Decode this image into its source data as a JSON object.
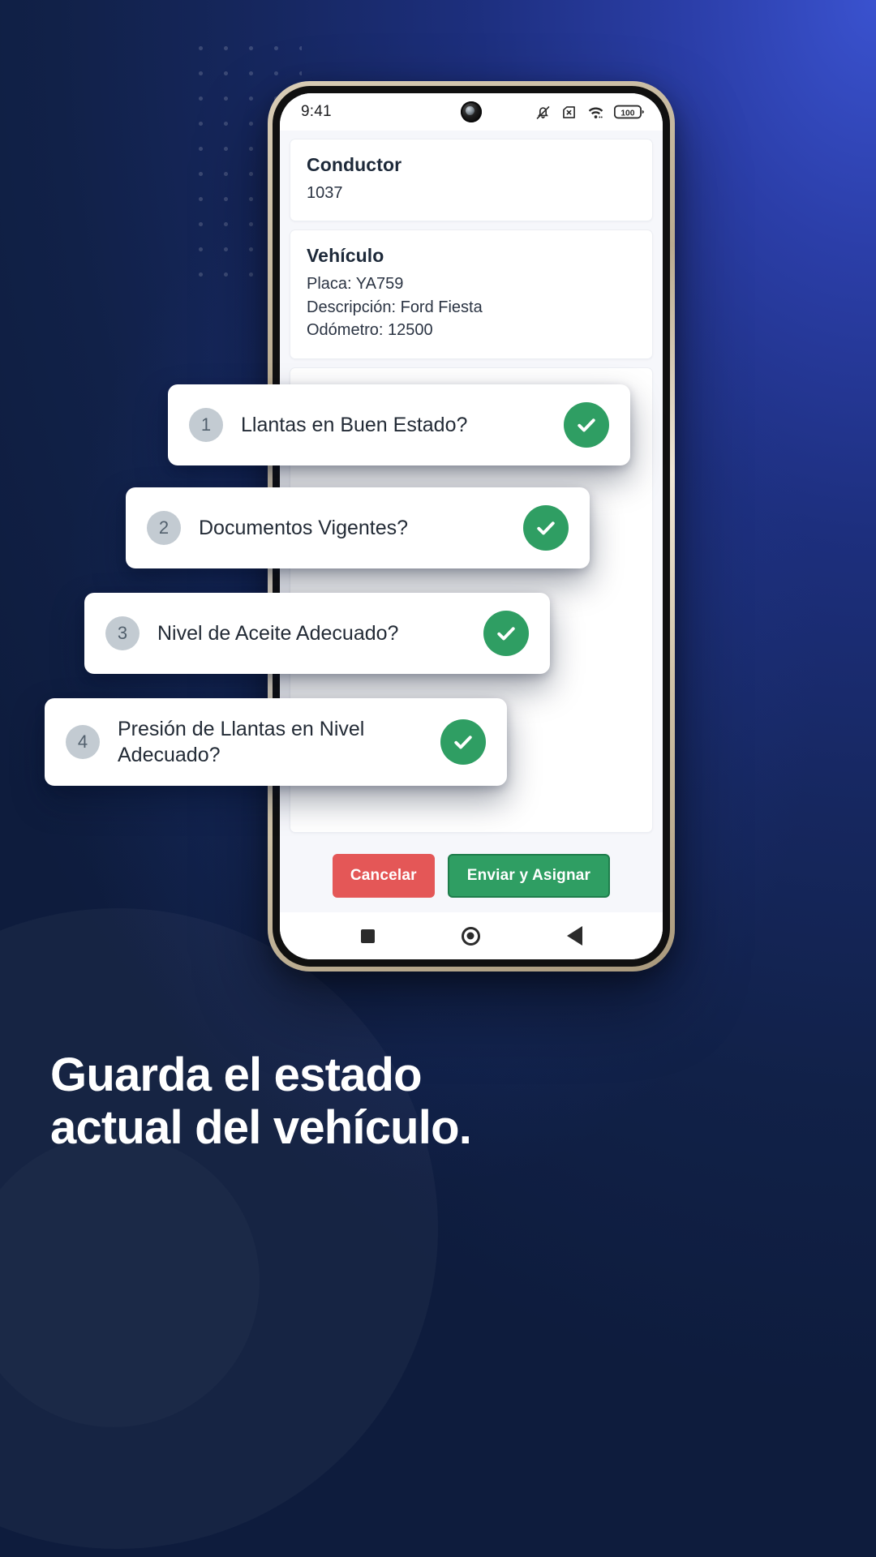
{
  "statusbar": {
    "time": "9:41",
    "icons": [
      "bell-muted-icon",
      "sim-card-off-icon",
      "wifi-icon",
      "battery-icon"
    ],
    "battery_level": "100"
  },
  "cards": {
    "driver": {
      "title": "Conductor",
      "value": "1037"
    },
    "vehicle": {
      "title": "Vehículo",
      "lines": [
        "Placa: YA759",
        "Descripción: Ford Fiesta",
        "Odómetro: 12500"
      ]
    }
  },
  "checklist": [
    {
      "number": "1",
      "label": "Llantas en Buen Estado?",
      "state": "checked"
    },
    {
      "number": "2",
      "label": "Documentos Vigentes?",
      "state": "checked"
    },
    {
      "number": "3",
      "label": "Nivel de Aceite Adecuado?",
      "state": "checked"
    },
    {
      "number": "4",
      "label": "Presión de Llantas en Nivel Adecuado?",
      "state": "checked"
    }
  ],
  "actions": {
    "cancel_label": "Cancelar",
    "submit_label": "Enviar y Asignar"
  },
  "navbar": {
    "recent_label": "recent-apps",
    "home_label": "home",
    "back_label": "back"
  },
  "headline": {
    "line1": "Guarda el estado",
    "line2": "actual del vehículo."
  },
  "colors": {
    "green": "#2F9E63",
    "red": "#E45757",
    "background_blue": "#1D2F7E",
    "card_white": "#FFFFFF",
    "number_chip": "#C3CBD2"
  }
}
